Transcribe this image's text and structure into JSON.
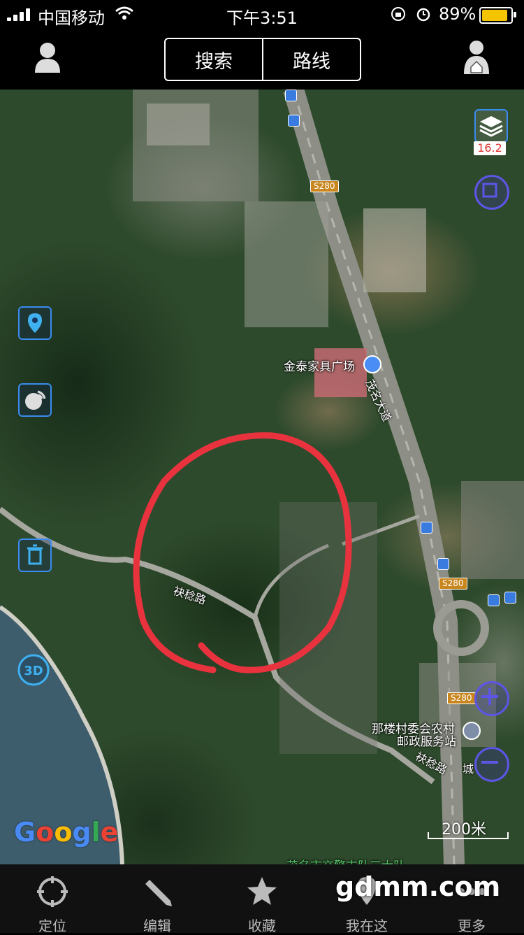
{
  "status_bar": {
    "carrier": "中国移动",
    "time": "下午3:51",
    "battery_percent_text": "89%",
    "battery_level": 0.89
  },
  "nav": {
    "search_label": "搜索",
    "route_label": "路线"
  },
  "map": {
    "zoom_level": "16.2",
    "scale_label": "200米",
    "google_logo": "Google",
    "labels": {
      "road_shield_1": "S280",
      "road_shield_2": "S280",
      "road_shield_3": "S280",
      "road_maoming": "茂名大道",
      "road_fuwen_1": "袂稔路",
      "road_fuwen_2": "袂稔路",
      "road_fuwen_3": "城",
      "poi_furniture": "金泰家具广场",
      "poi_post_line1": "那楼村委会农村",
      "poi_post_line2": "邮政服务站",
      "poi_bottom": "茂名市交警支队三大队"
    },
    "colors": {
      "circle": "#e8333f",
      "accent": "#3a8cf0",
      "zoom_btn": "#5d55e6"
    }
  },
  "tabs": [
    {
      "label": "定位",
      "icon": "crosshair-icon"
    },
    {
      "label": "编辑",
      "icon": "pencil-icon"
    },
    {
      "label": "收藏",
      "icon": "star-icon"
    },
    {
      "label": "我在这",
      "icon": "pin-icon"
    },
    {
      "label": "更多",
      "icon": "more-icon"
    }
  ],
  "watermark": "gdmm.com"
}
